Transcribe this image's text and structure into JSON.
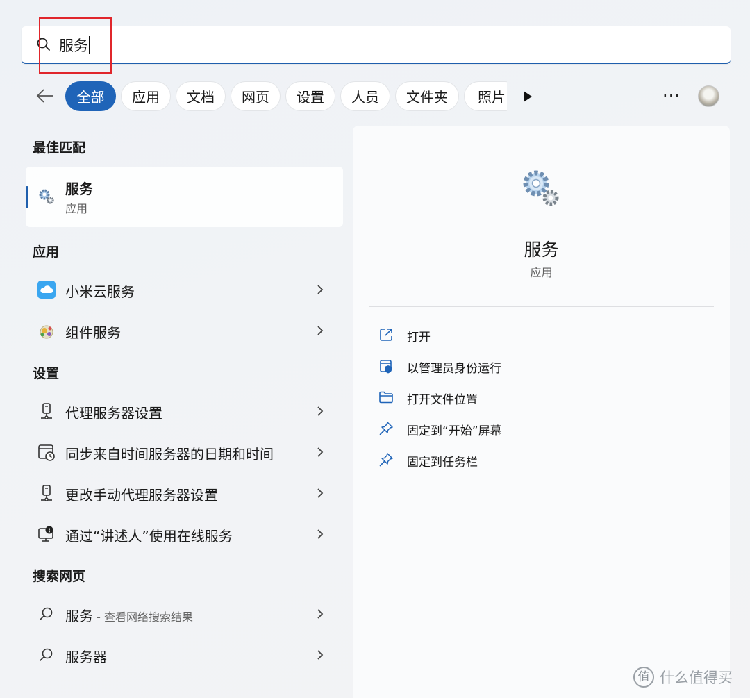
{
  "search": {
    "query": "服务"
  },
  "filters": {
    "chips": [
      "全部",
      "应用",
      "文档",
      "网页",
      "设置",
      "人员",
      "文件夹",
      "照片"
    ],
    "more_label": "···"
  },
  "sections": {
    "best_match": "最佳匹配",
    "apps": "应用",
    "settings": "设置",
    "web": "搜索网页"
  },
  "best": {
    "title": "服务",
    "subtitle": "应用"
  },
  "apps": [
    {
      "label": "小米云服务",
      "icon": "cloud-icon"
    },
    {
      "label": "组件服务",
      "icon": "component-services-icon"
    }
  ],
  "settings": [
    {
      "label": "代理服务器设置",
      "icon": "proxy-icon"
    },
    {
      "label": "同步来自时间服务器的日期和时间",
      "icon": "calendar-clock-icon"
    },
    {
      "label": "更改手动代理服务器设置",
      "icon": "proxy-icon"
    },
    {
      "label": "通过“讲述人”使用在线服务",
      "icon": "narrator-icon"
    }
  ],
  "web": [
    {
      "label": "服务",
      "sub": " - 查看网络搜索结果",
      "icon": "search-icon"
    },
    {
      "label": "服务器",
      "icon": "search-icon"
    }
  ],
  "detail": {
    "title": "服务",
    "subtitle": "应用",
    "actions": [
      {
        "label": "打开",
        "icon": "open-external-icon"
      },
      {
        "label": "以管理员身份运行",
        "icon": "admin-shield-icon"
      },
      {
        "label": "打开文件位置",
        "icon": "folder-icon"
      },
      {
        "label": "固定到“开始”屏幕",
        "icon": "pin-icon"
      },
      {
        "label": "固定到任务栏",
        "icon": "pin-icon"
      }
    ]
  },
  "watermark": {
    "logo": "值",
    "text": "什么值得买"
  },
  "colors": {
    "accent": "#1f64b8",
    "highlight": "#e0262b"
  }
}
